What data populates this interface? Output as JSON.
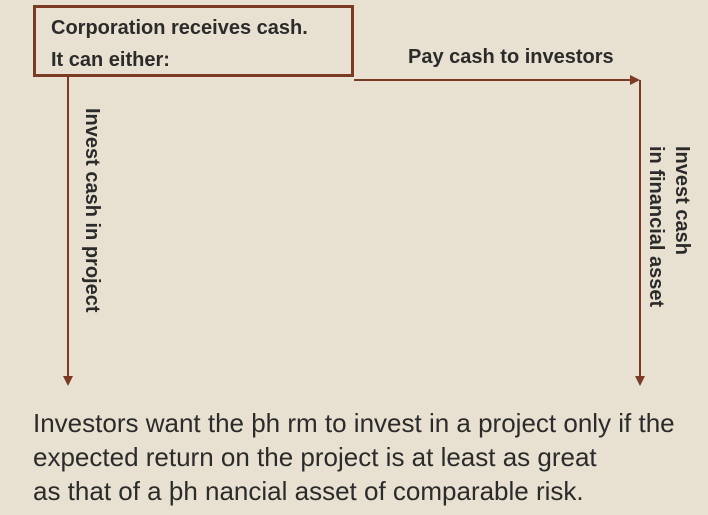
{
  "box": {
    "line1": "Corporation receives cash.",
    "line2": "It can either:"
  },
  "options": {
    "pay": "Pay cash to investors",
    "project": "Invest cash in project",
    "financial_line1": "Invest cash",
    "financial_line2": "in financial asset"
  },
  "caption": {
    "line1": "Investors want the þh rm to invest in a project only if the",
    "line2": "expected return on the project is at least as great",
    "line3": "as that of a þh nancial asset of comparable risk."
  },
  "colors": {
    "background": "#e8e1d1",
    "accent": "#7a3a24",
    "text": "#2b2b2b"
  }
}
